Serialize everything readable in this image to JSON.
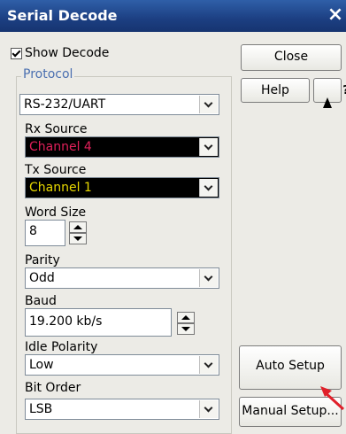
{
  "window": {
    "title": "Serial Decode",
    "close_glyph": "×"
  },
  "show_decode": {
    "label": "Show Decode",
    "checked": true
  },
  "protocol": {
    "label": "Protocol",
    "value": "RS-232/UART"
  },
  "rx_source": {
    "label": "Rx Source",
    "value": "Channel 4",
    "color": "#e0205a"
  },
  "tx_source": {
    "label": "Tx Source",
    "value": "Channel 1",
    "color": "#e8d800"
  },
  "word_size": {
    "label": "Word Size",
    "value": "8"
  },
  "parity": {
    "label": "Parity",
    "value": "Odd"
  },
  "baud": {
    "label": "Baud",
    "value": "19.200 kb/s"
  },
  "idle_polarity": {
    "label": "Idle Polarity",
    "value": "Low"
  },
  "bit_order": {
    "label": "Bit Order",
    "value": "LSB"
  },
  "buttons": {
    "close": "Close",
    "help": "Help",
    "whats_this": "?",
    "auto_setup": "Auto Setup",
    "manual_setup": "Manual Setup..."
  },
  "colors": {
    "title_bar": "#1c3f82",
    "group_label": "#4a6fb0",
    "annotation_arrow": "#e0202a"
  }
}
